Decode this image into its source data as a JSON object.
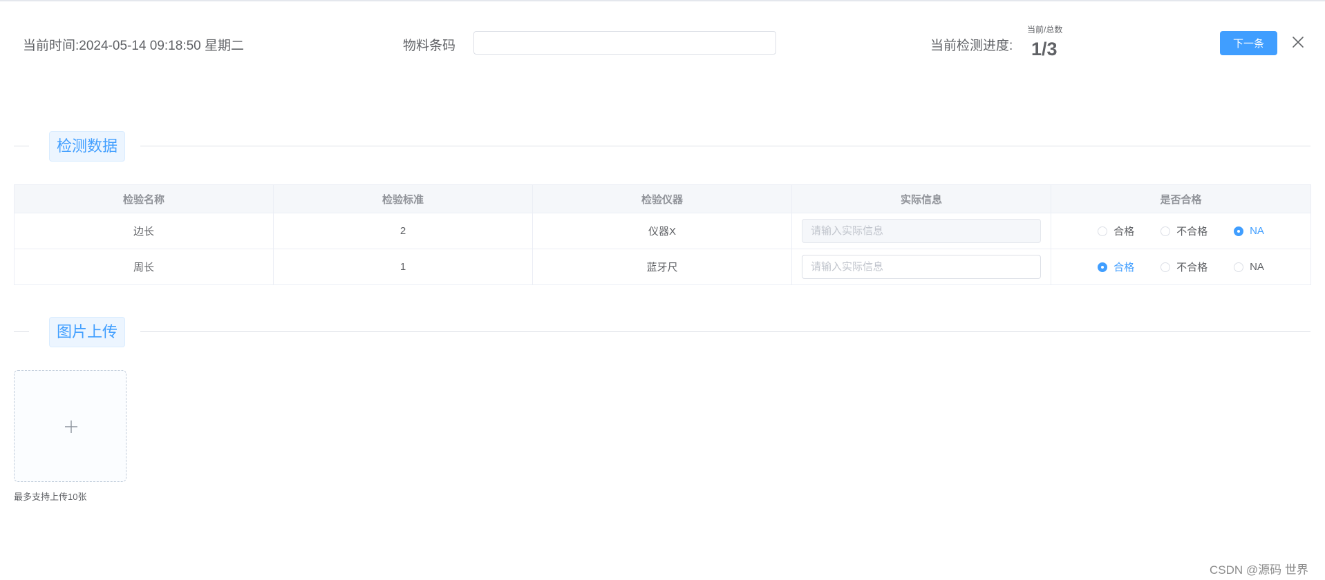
{
  "header": {
    "current_time": "当前时间:2024-05-14 09:18:50 星期二",
    "barcode_label": "物料条码",
    "barcode_value": "",
    "progress_label": "当前检测进度:",
    "progress_caption": "当前/总数",
    "progress_value": "1/3",
    "next_button": "下一条"
  },
  "sections": {
    "data_title": "检测数据",
    "upload_title": "图片上传"
  },
  "table": {
    "headers": [
      "检验名称",
      "检验标准",
      "检验仪器",
      "实际信息",
      "是否合格"
    ],
    "rows": [
      {
        "name": "边长",
        "standard": "2",
        "instrument": "仪器X",
        "actual_value": "",
        "actual_placeholder": "请输入实际信息",
        "input_disabled": true,
        "options": [
          "合格",
          "不合格",
          "NA"
        ],
        "selected": "NA"
      },
      {
        "name": "周长",
        "standard": "1",
        "instrument": "蓝牙尺",
        "actual_value": "",
        "actual_placeholder": "请输入实际信息",
        "input_disabled": false,
        "options": [
          "合格",
          "不合格",
          "NA"
        ],
        "selected": "合格"
      }
    ]
  },
  "upload": {
    "tip": "最多支持上传10张"
  },
  "watermark": "CSDN @源码 世界",
  "colors": {
    "accent": "#409eff",
    "text": "#606266",
    "border": "#dcdfe6",
    "header_bg": "#f5f7fa"
  },
  "icons": {
    "close": "close-icon",
    "upload": "plus-icon"
  }
}
